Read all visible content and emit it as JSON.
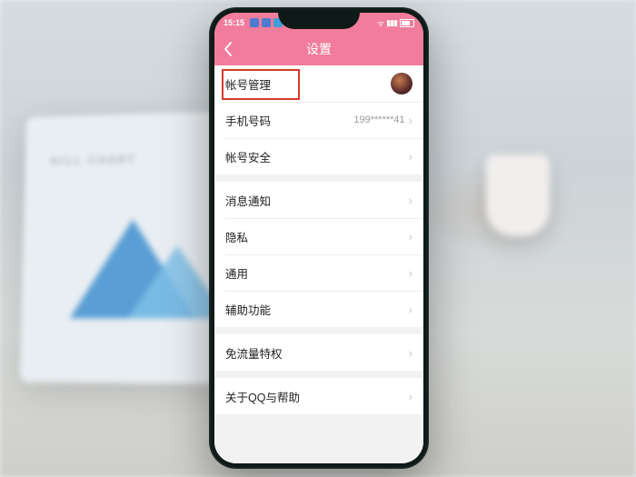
{
  "statusbar": {
    "time": "15:15"
  },
  "header": {
    "title": "设置"
  },
  "groups": [
    {
      "rows": [
        {
          "key": "account",
          "label": "帐号管理",
          "hasAvatar": true
        },
        {
          "key": "phone",
          "label": "手机号码",
          "value": "199******41"
        },
        {
          "key": "security",
          "label": "帐号安全"
        }
      ]
    },
    {
      "rows": [
        {
          "key": "notifications",
          "label": "消息通知"
        },
        {
          "key": "privacy",
          "label": "隐私"
        },
        {
          "key": "general",
          "label": "通用"
        },
        {
          "key": "accessibility",
          "label": "辅助功能"
        }
      ]
    },
    {
      "rows": [
        {
          "key": "datafree",
          "label": "免流量特权"
        }
      ]
    },
    {
      "rows": [
        {
          "key": "about",
          "label": "关于QQ与帮助"
        }
      ]
    }
  ],
  "highlight_row_key": "account"
}
